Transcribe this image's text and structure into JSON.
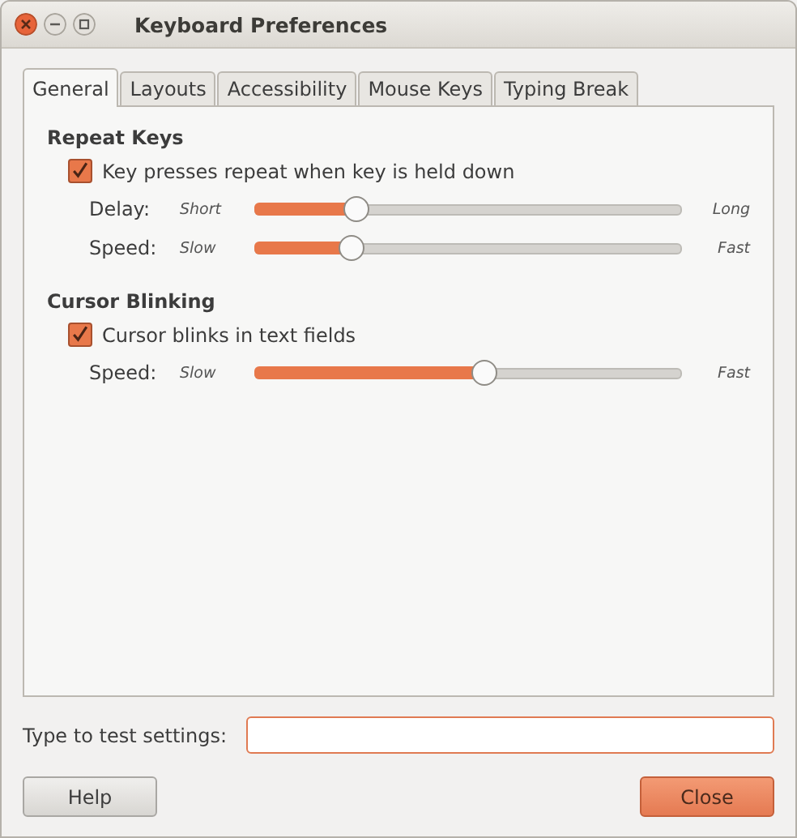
{
  "window": {
    "title": "Keyboard Preferences"
  },
  "tabs": [
    {
      "label": "General",
      "selected": true
    },
    {
      "label": "Layouts",
      "selected": false
    },
    {
      "label": "Accessibility",
      "selected": false
    },
    {
      "label": "Mouse Keys",
      "selected": false
    },
    {
      "label": "Typing Break",
      "selected": false
    }
  ],
  "sections": [
    {
      "heading": "Repeat Keys",
      "checkbox": {
        "label": "Key presses repeat when key is held down",
        "checked": true
      },
      "sliders": [
        {
          "label": "Delay:",
          "min_label": "Short",
          "max_label": "Long",
          "level": 0.22
        },
        {
          "label": "Speed:",
          "min_label": "Slow",
          "max_label": "Fast",
          "level": 0.21
        }
      ]
    },
    {
      "heading": "Cursor Blinking",
      "checkbox": {
        "label": "Cursor blinks in text fields",
        "checked": true
      },
      "sliders": [
        {
          "label": "Speed:",
          "min_label": "Slow",
          "max_label": "Fast",
          "level": 0.54
        }
      ]
    }
  ],
  "test_field": {
    "label": "Type to test settings:"
  },
  "buttons": [
    {
      "label": "Help",
      "default": false
    },
    {
      "label": "Close",
      "default": true
    }
  ]
}
